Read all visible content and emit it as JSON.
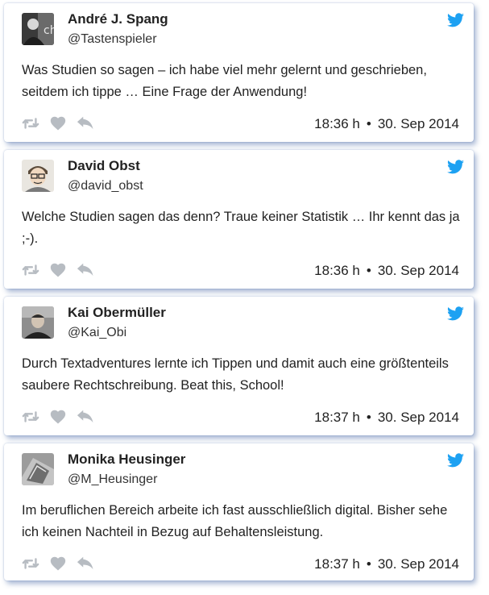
{
  "colors": {
    "twitter_blue": "#1da1f2",
    "icon_gray": "#b7bcc2",
    "shadow": "#3c5fa0"
  },
  "icons": {
    "brand": "twitter-bird-icon",
    "retweet": "retweet-icon",
    "like": "heart-icon",
    "reply": "reply-icon"
  },
  "tweets": [
    {
      "name": "André J. Spang",
      "handle": "@Tastenspieler",
      "text": "Was Studien so sagen – ich habe viel mehr gelernt und geschrieben, seitdem ich tippe … Eine Frage der Anwendung!",
      "time": "18:36 h",
      "date": "30. Sep 2014"
    },
    {
      "name": "David Obst",
      "handle": "@david_obst",
      "text": "Welche Studien sagen das denn? Traue keiner Statistik … Ihr kennt das ja ;-).",
      "time": "18:36 h",
      "date": "30. Sep 2014"
    },
    {
      "name": "Kai Obermüller",
      "handle": "@Kai_Obi",
      "text": "Durch Textadventures lernte ich Tippen und damit auch eine größtenteils saubere Rechtschreibung. Beat this, School!",
      "time": "18:37 h",
      "date": "30. Sep 2014"
    },
    {
      "name": "Monika Heusinger",
      "handle": "@M_Heusinger",
      "text": "Im beruflichen Bereich arbeite ich fast ausschließlich digital. Bisher sehe ich keinen Nachteil in Bezug auf Behaltensleistung.",
      "time": "18:37 h",
      "date": "30. Sep 2014"
    }
  ]
}
